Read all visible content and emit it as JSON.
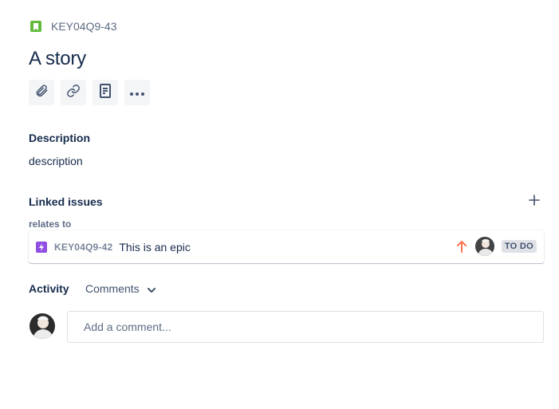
{
  "issue": {
    "key": "KEY04Q9-43",
    "title": "A story",
    "type_icon": "story-icon"
  },
  "toolbar": {
    "buttons": [
      {
        "icon": "paperclip-icon"
      },
      {
        "icon": "link-icon"
      },
      {
        "icon": "document-icon"
      },
      {
        "icon": "more-icon"
      }
    ]
  },
  "description": {
    "heading": "Description",
    "text": "description"
  },
  "linked_issues": {
    "heading": "Linked issues",
    "add_icon": "plus-icon",
    "relation_label": "relates to",
    "items": [
      {
        "type_icon": "epic-icon",
        "key": "KEY04Q9-42",
        "summary": "This is an epic",
        "priority_icon": "arrow-up-icon",
        "status": "TO DO"
      }
    ]
  },
  "activity": {
    "heading": "Activity",
    "filter_value": "Comments",
    "comment_placeholder": "Add a comment..."
  },
  "colors": {
    "story": "#63ba3c",
    "epic": "#904ee2",
    "priority_high": "#ff7452",
    "text_primary": "#172b4d",
    "text_subtle": "#5e6c84"
  }
}
